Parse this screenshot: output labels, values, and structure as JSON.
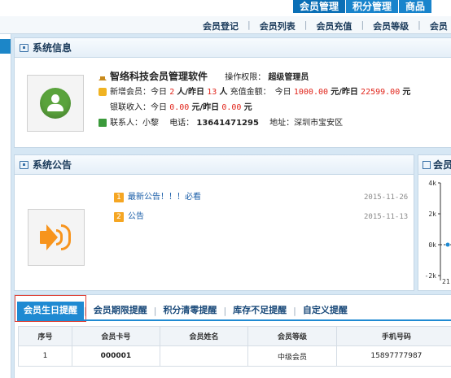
{
  "top_nav": {
    "tabs": [
      "会员管理",
      "积分管理",
      "商品"
    ]
  },
  "sub_nav": {
    "items": [
      "会员登记",
      "会员列表",
      "会员充值",
      "会员等级",
      "会员"
    ]
  },
  "system_info": {
    "title": "系统信息",
    "company": "智络科技会员管理软件",
    "permission_label": "操作权限：",
    "permission_value": "超级管理员",
    "stats": {
      "new_members_label": "新增会员：今日",
      "today_new": "2",
      "yesterday_label": "人/昨日",
      "yesterday_new": "13",
      "people_unit": "人",
      "recharge_label": "充值金额：　今日",
      "today_recharge": "1000.00",
      "recharge_mid": "元/昨日",
      "yesterday_recharge": "22599.00",
      "recharge_unit": "元",
      "card_label": "银联收入：今日",
      "today_card": "0.00",
      "card_mid": "元/昨日",
      "yesterday_card": "0.00",
      "card_unit": "元"
    },
    "contact": {
      "contact_label": "联系人：小黎",
      "phone_label": "电话：",
      "phone": "13641471295",
      "address_label": "地址：深圳市宝安区"
    }
  },
  "notice": {
    "title": "系统公告",
    "items": [
      {
        "num": "1",
        "title": "最新公告！！！必看",
        "date": "2015-11-26"
      },
      {
        "num": "2",
        "title": "公告",
        "date": "2015-11-13"
      }
    ]
  },
  "chart": {
    "title": "会员",
    "type": "line",
    "y_ticks": [
      "4k",
      "2k",
      "0k",
      "-2k"
    ],
    "x_tick": "21"
  },
  "chart_data": {
    "type": "line",
    "title": "会员",
    "y_ticks": [
      "4k",
      "2k",
      "0k",
      "-2k"
    ],
    "x_ticks": [
      "21"
    ],
    "series": [
      {
        "values": [
          0
        ]
      }
    ]
  },
  "reminder_tabs": {
    "tabs": [
      "会员生日提醒",
      "会员期限提醒",
      "积分清零提醒",
      "库存不足提醒",
      "自定义提醒"
    ],
    "active": "会员生日提醒"
  },
  "table": {
    "columns": [
      "序号",
      "会员卡号",
      "会员姓名",
      "会员等级",
      "手机号码"
    ],
    "rows": [
      [
        "1",
        "000001",
        "",
        "中级会员",
        "15897777987"
      ]
    ]
  },
  "colors": {
    "accent": "#1f8ad2",
    "highlight": "#e1251b"
  }
}
